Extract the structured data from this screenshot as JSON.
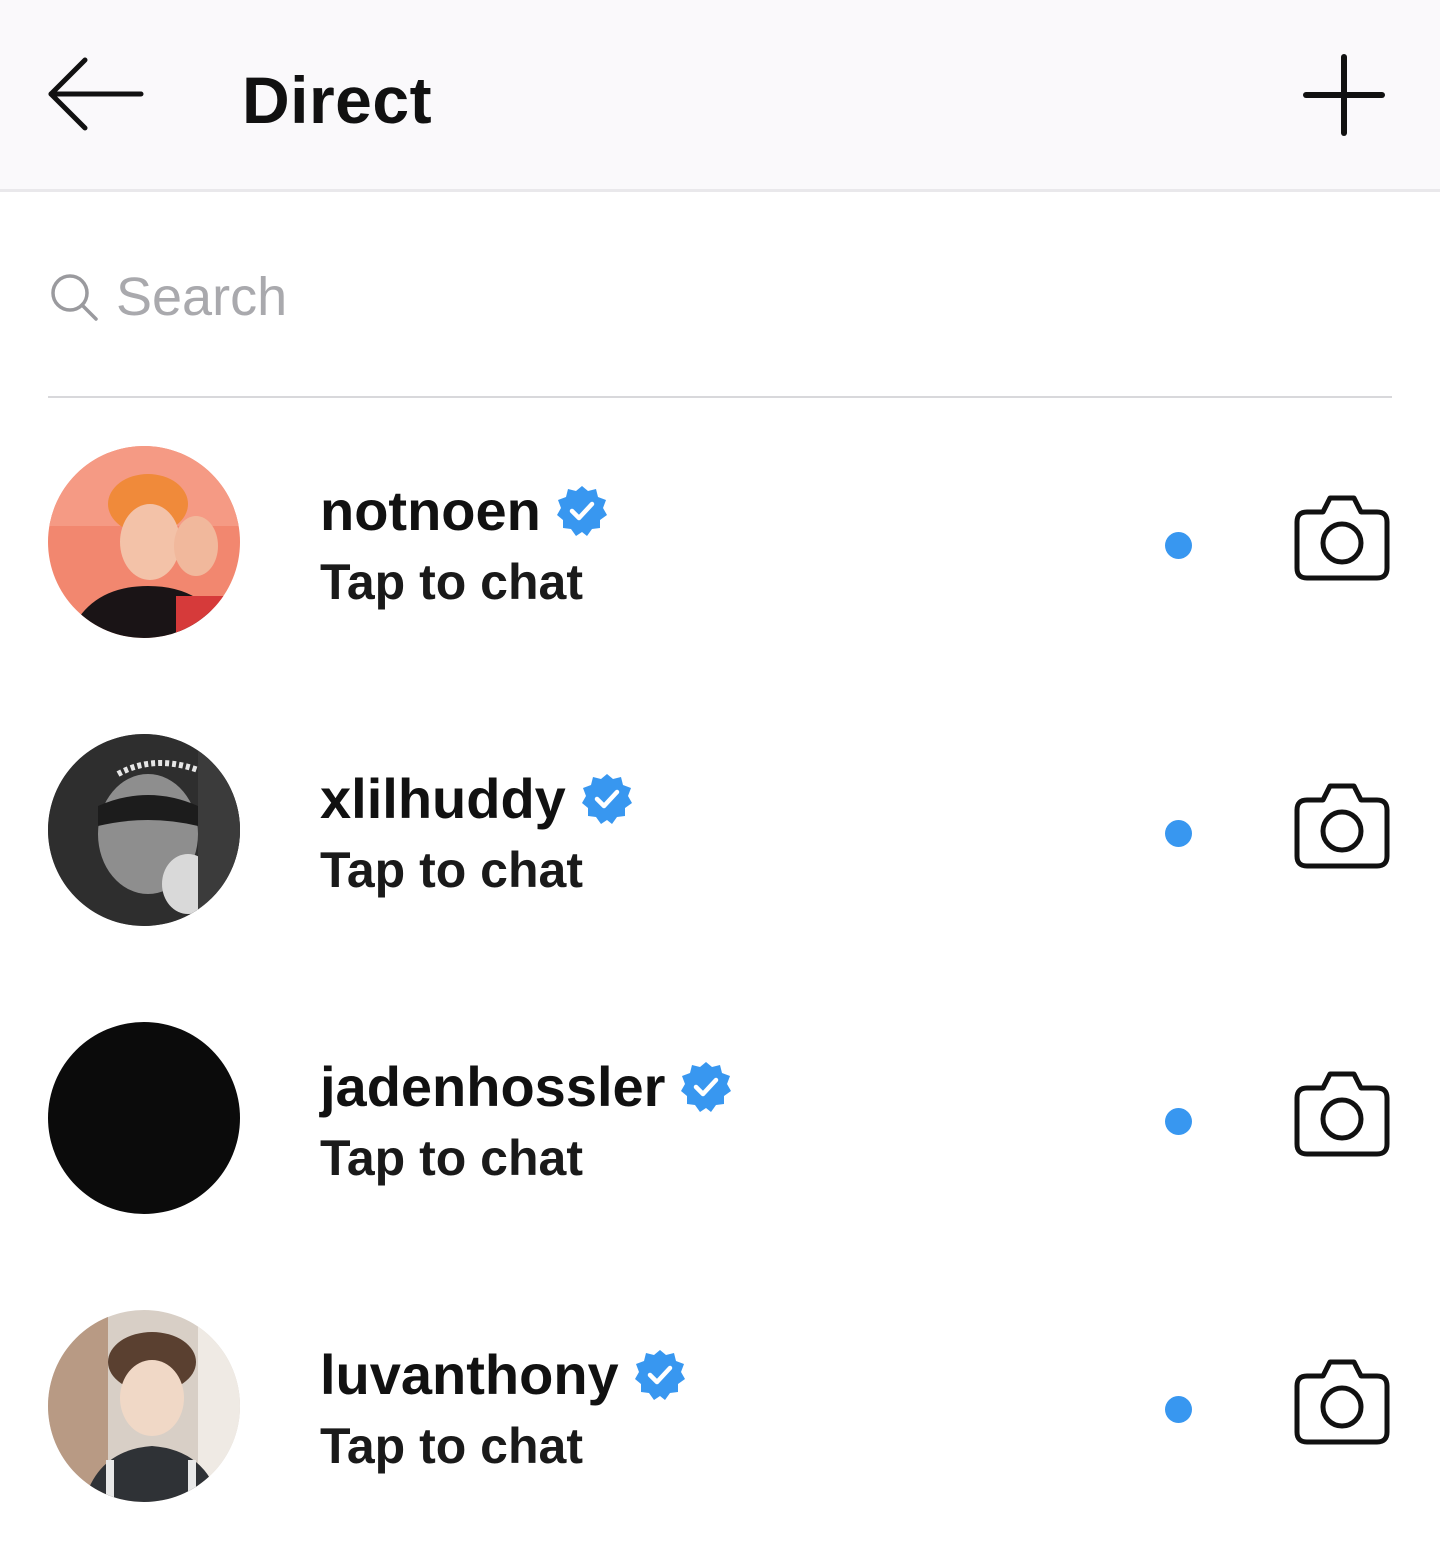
{
  "header": {
    "title": "Direct",
    "back_icon": "arrow-left-icon",
    "new_icon": "plus-icon"
  },
  "search": {
    "placeholder": "Search",
    "value": "",
    "icon": "search-icon"
  },
  "colors": {
    "verified_badge": "#3897f0",
    "unread_dot": "#3897f0",
    "header_bg": "#faf9fb",
    "text": "#111111",
    "placeholder": "#a9a9ad"
  },
  "conversations": [
    {
      "username": "notnoen",
      "verified": true,
      "subtitle": "Tap to chat",
      "unread": true,
      "action_icon": "camera-icon"
    },
    {
      "username": "xlilhuddy",
      "verified": true,
      "subtitle": "Tap to chat",
      "unread": true,
      "action_icon": "camera-icon"
    },
    {
      "username": "jadenhossler",
      "verified": true,
      "subtitle": "Tap to chat",
      "unread": true,
      "action_icon": "camera-icon"
    },
    {
      "username": "luvanthony",
      "verified": true,
      "subtitle": "Tap to chat",
      "unread": true,
      "action_icon": "camera-icon"
    }
  ]
}
